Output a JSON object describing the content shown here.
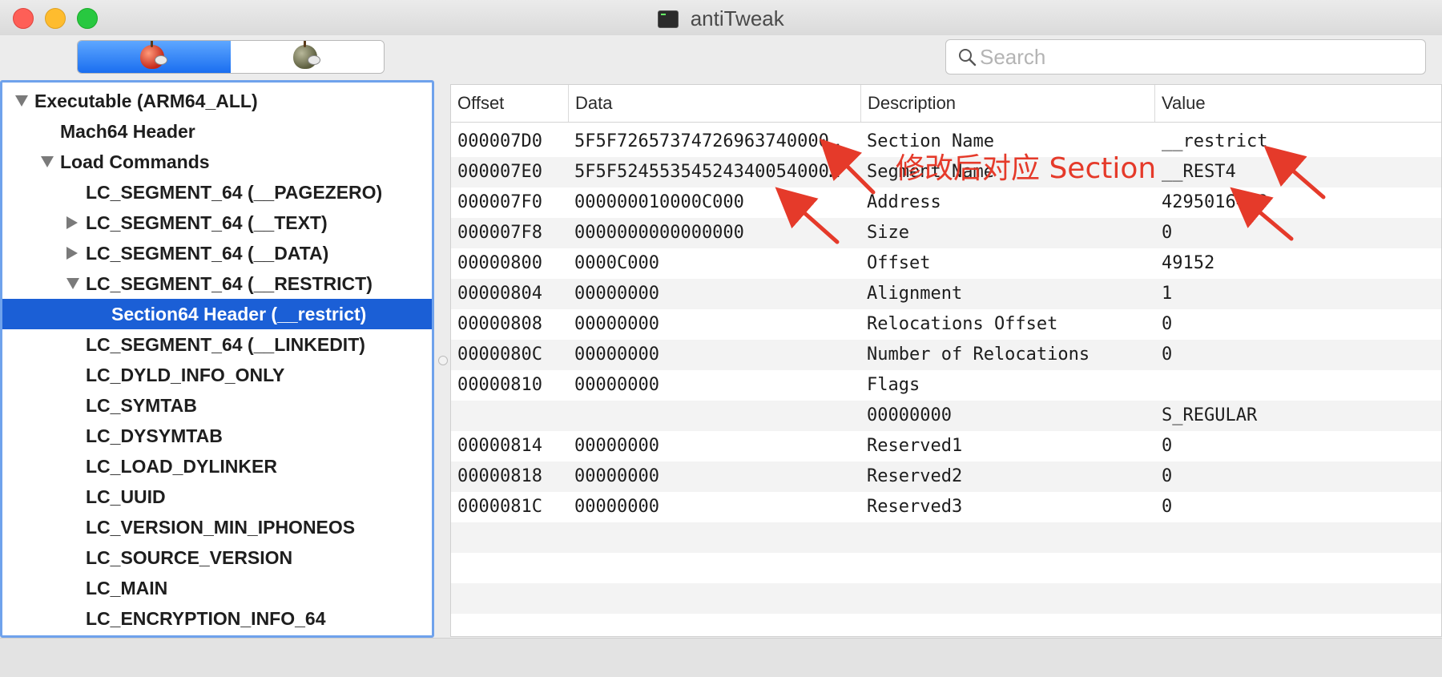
{
  "window": {
    "title": "antiTweak"
  },
  "search": {
    "placeholder": "Search",
    "value": ""
  },
  "tree": {
    "rows": [
      {
        "label": "Executable  (ARM64_ALL)",
        "indent": 0,
        "disclosure": "down"
      },
      {
        "label": "Mach64 Header",
        "indent": 1,
        "disclosure": "none"
      },
      {
        "label": "Load Commands",
        "indent": 1,
        "disclosure": "down"
      },
      {
        "label": "LC_SEGMENT_64 (__PAGEZERO)",
        "indent": 2,
        "disclosure": "none"
      },
      {
        "label": "LC_SEGMENT_64 (__TEXT)",
        "indent": 2,
        "disclosure": "right"
      },
      {
        "label": "LC_SEGMENT_64 (__DATA)",
        "indent": 2,
        "disclosure": "right"
      },
      {
        "label": "LC_SEGMENT_64 (__RESTRICT)",
        "indent": 2,
        "disclosure": "down"
      },
      {
        "label": "Section64 Header (__restrict)",
        "indent": 3,
        "disclosure": "none",
        "selected": true
      },
      {
        "label": "LC_SEGMENT_64 (__LINKEDIT)",
        "indent": 2,
        "disclosure": "none"
      },
      {
        "label": "LC_DYLD_INFO_ONLY",
        "indent": 2,
        "disclosure": "none"
      },
      {
        "label": "LC_SYMTAB",
        "indent": 2,
        "disclosure": "none"
      },
      {
        "label": "LC_DYSYMTAB",
        "indent": 2,
        "disclosure": "none"
      },
      {
        "label": "LC_LOAD_DYLINKER",
        "indent": 2,
        "disclosure": "none"
      },
      {
        "label": "LC_UUID",
        "indent": 2,
        "disclosure": "none"
      },
      {
        "label": "LC_VERSION_MIN_IPHONEOS",
        "indent": 2,
        "disclosure": "none"
      },
      {
        "label": "LC_SOURCE_VERSION",
        "indent": 2,
        "disclosure": "none"
      },
      {
        "label": "LC_MAIN",
        "indent": 2,
        "disclosure": "none"
      },
      {
        "label": "LC_ENCRYPTION_INFO_64",
        "indent": 2,
        "disclosure": "none"
      }
    ]
  },
  "table": {
    "headers": [
      "Offset",
      "Data",
      "Description",
      "Value"
    ],
    "rows": [
      {
        "offset": "000007D0",
        "data": "5F5F72657374726963740000…",
        "desc": "Section Name",
        "value": "__restrict"
      },
      {
        "offset": "000007E0",
        "data": "5F5F52455354524340054000…",
        "desc": "Segment Name",
        "value": "__REST4"
      },
      {
        "offset": "000007F0",
        "data": "000000010000C000",
        "desc": "Address",
        "value": "4295016448"
      },
      {
        "offset": "000007F8",
        "data": "0000000000000000",
        "desc": "Size",
        "value": "0"
      },
      {
        "offset": "00000800",
        "data": "0000C000",
        "desc": "Offset",
        "value": "49152"
      },
      {
        "offset": "00000804",
        "data": "00000000",
        "desc": "Alignment",
        "value": "1"
      },
      {
        "offset": "00000808",
        "data": "00000000",
        "desc": "Relocations Offset",
        "value": "0"
      },
      {
        "offset": "0000080C",
        "data": "00000000",
        "desc": "Number of Relocations",
        "value": "0"
      },
      {
        "offset": "00000810",
        "data": "00000000",
        "desc": "Flags",
        "value": ""
      },
      {
        "offset": "",
        "data": "",
        "desc": "00000000",
        "value": "S_REGULAR"
      },
      {
        "offset": "00000814",
        "data": "00000000",
        "desc": "Reserved1",
        "value": "0"
      },
      {
        "offset": "00000818",
        "data": "00000000",
        "desc": "Reserved2",
        "value": "0"
      },
      {
        "offset": "0000081C",
        "data": "00000000",
        "desc": "Reserved3",
        "value": "0"
      }
    ]
  },
  "annotation": {
    "text": "修改后对应 Section",
    "color": "#e53a2a"
  }
}
